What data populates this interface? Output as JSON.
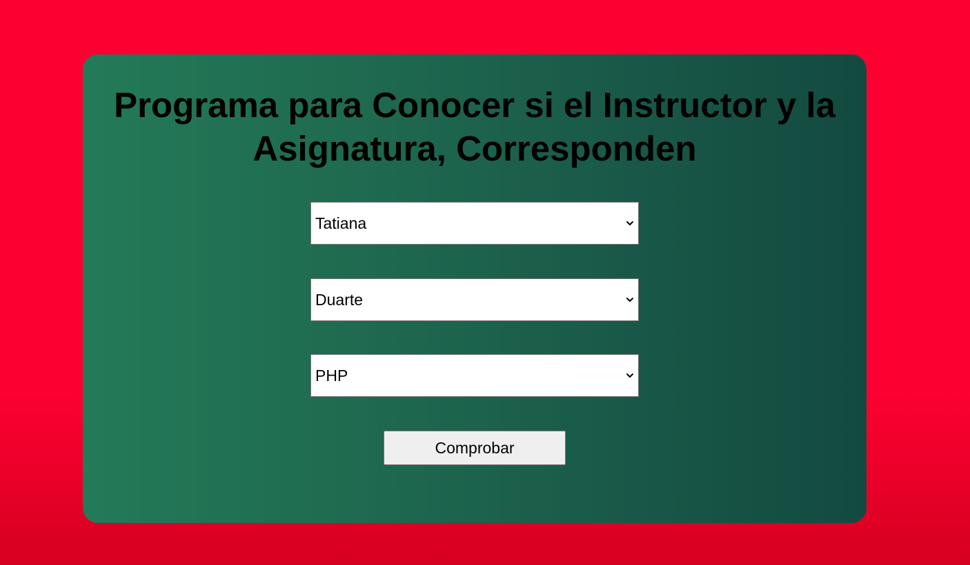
{
  "page": {
    "title": "Programa para Conocer si el Instructor y la Asignatura, Corresponden"
  },
  "form": {
    "selects": [
      {
        "value": "Tatiana",
        "icon": "chevron-down-icon"
      },
      {
        "value": "Duarte",
        "icon": "chevron-down-icon"
      },
      {
        "value": "PHP",
        "icon": "chevron-down-icon"
      }
    ],
    "submit_label": "Comprobar"
  },
  "colors": {
    "page_background": "#fb0030",
    "card_gradient_start": "#237a58",
    "card_gradient_end": "#134a40",
    "button_background": "#efefef"
  }
}
